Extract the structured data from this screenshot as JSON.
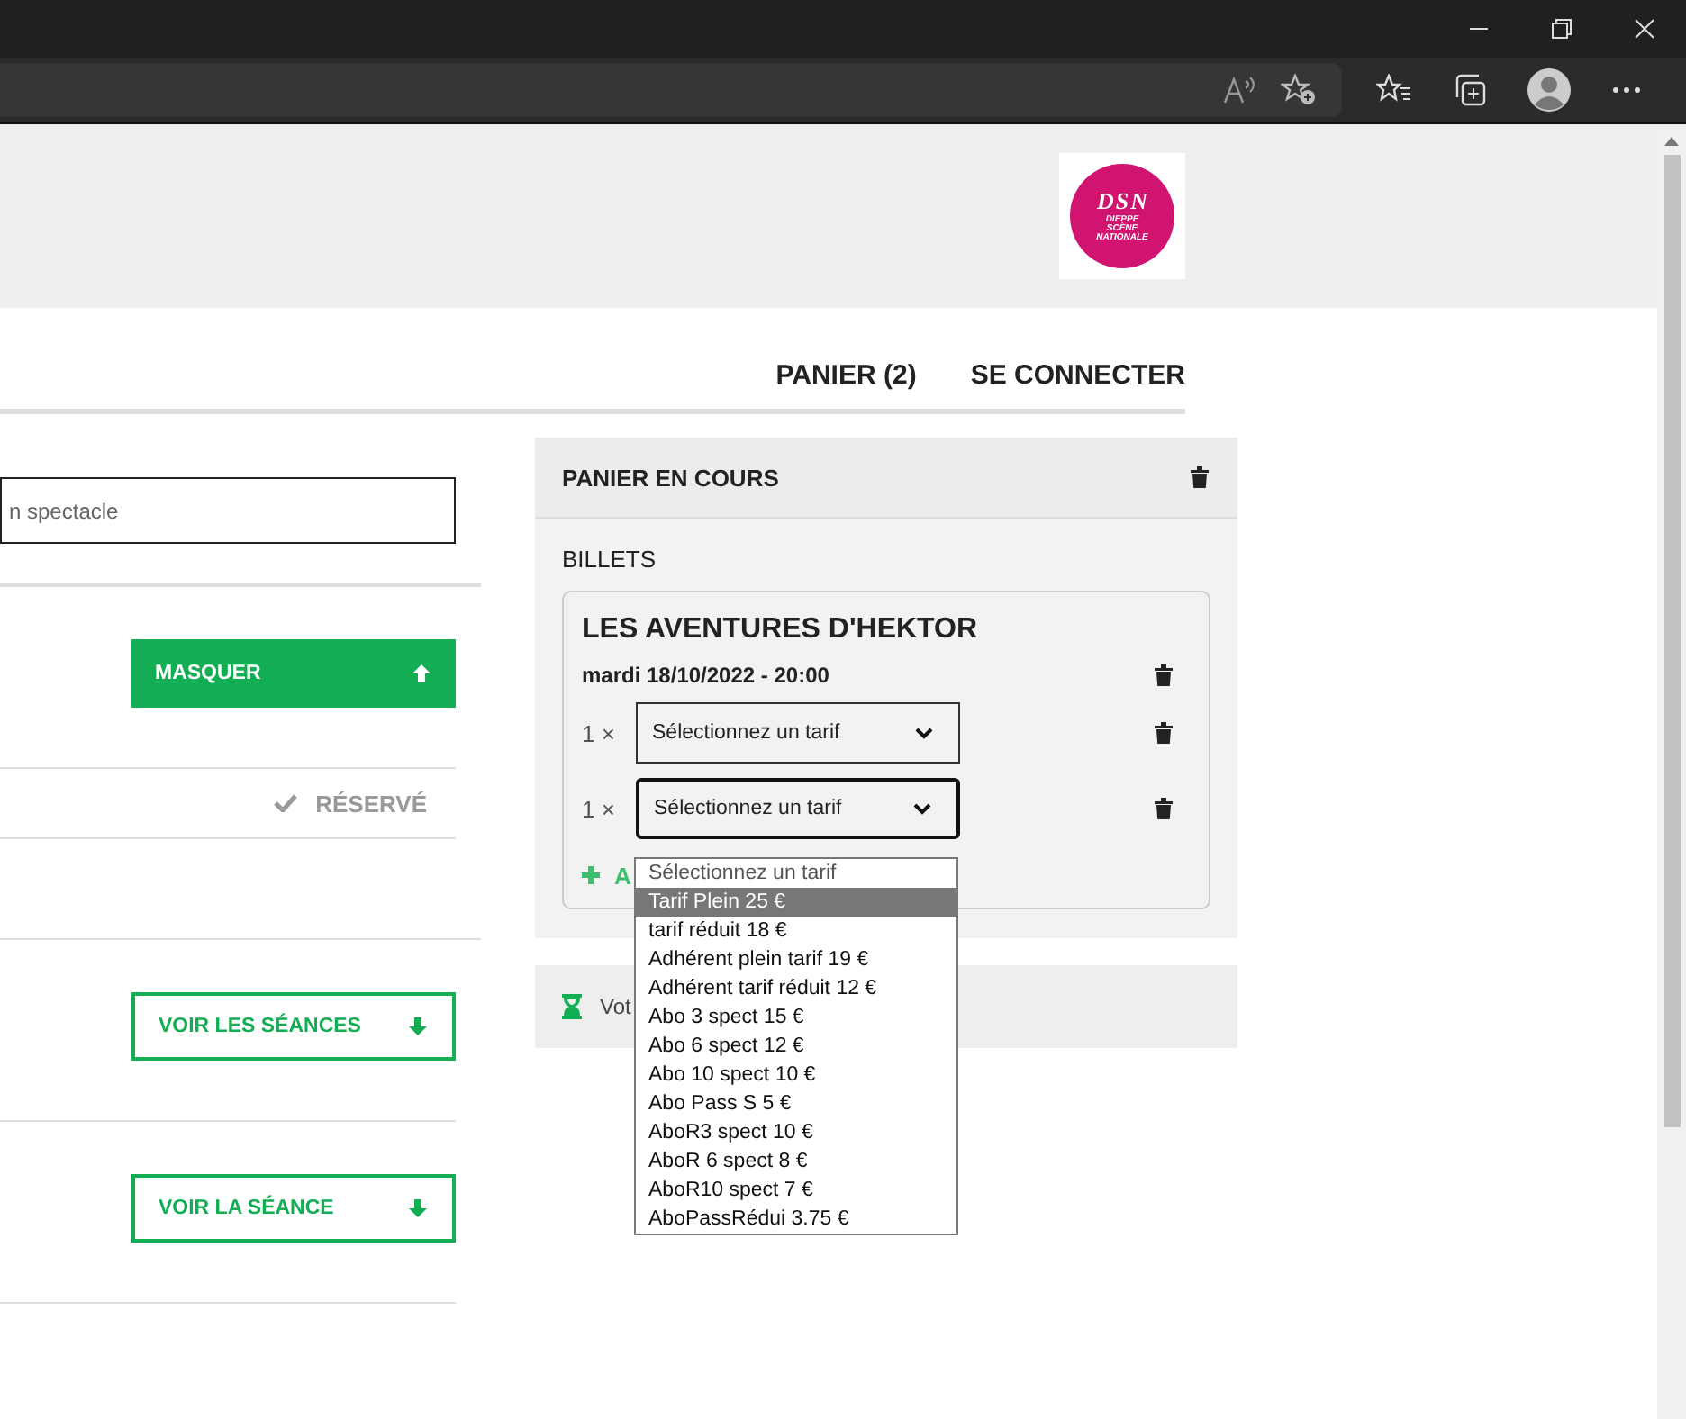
{
  "logo": {
    "letters": [
      "D",
      "S",
      "N"
    ],
    "lines": [
      "DIEPPE",
      "SCÈNE",
      "NATIONALE"
    ]
  },
  "nav": [
    {
      "label": "PANIER (2)"
    },
    {
      "label": "SE CONNECTER"
    }
  ],
  "search": {
    "placeholder": "n spectacle"
  },
  "left_rows": [
    {
      "kind": "hide",
      "label": "MASQUER"
    },
    {
      "kind": "status",
      "label": "RÉSERVÉ"
    },
    {
      "kind": "empty"
    },
    {
      "kind": "show",
      "label": "VOIR LES SÉANCES"
    },
    {
      "kind": "show",
      "label": "VOIR LA SÉANCE"
    }
  ],
  "cart": {
    "title": "PANIER EN COURS",
    "section": "BILLETS",
    "show": "LES AVENTURES D'HEKTOR",
    "date": "mardi 18/10/2022 - 20:00",
    "tickets": [
      {
        "qty": "1 ×",
        "value": "Sélectionnez un tarif",
        "focused": false
      },
      {
        "qty": "1 ×",
        "value": "Sélectionnez un tarif",
        "focused": true
      }
    ],
    "add_label": "A",
    "timer_text": "Vot"
  },
  "dropdown": {
    "options": [
      {
        "label": "Sélectionnez un tarif",
        "selected": false
      },
      {
        "label": "Tarif Plein 25 €",
        "selected": true
      },
      {
        "label": "tarif réduit 18 €",
        "selected": false
      },
      {
        "label": "Adhérent plein tarif 19 €",
        "selected": false
      },
      {
        "label": "Adhérent tarif réduit 12 €",
        "selected": false
      },
      {
        "label": "Abo 3 spect 15 €",
        "selected": false
      },
      {
        "label": "Abo 6 spect 12 €",
        "selected": false
      },
      {
        "label": "Abo 10 spect 10 €",
        "selected": false
      },
      {
        "label": "Abo Pass S 5 €",
        "selected": false
      },
      {
        "label": "AboR3 spect 10 €",
        "selected": false
      },
      {
        "label": "AboR 6 spect 8 €",
        "selected": false
      },
      {
        "label": "AboR10 spect 7 €",
        "selected": false
      },
      {
        "label": "AboPassRédui 3.75 €",
        "selected": false
      }
    ]
  }
}
